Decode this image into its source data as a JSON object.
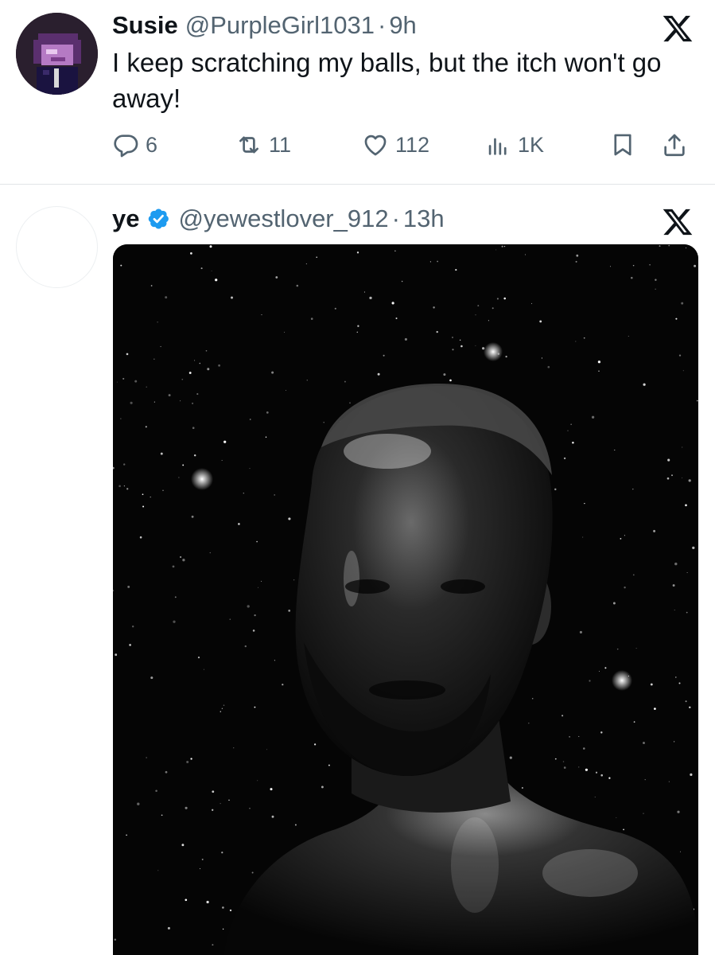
{
  "tweets": [
    {
      "display_name": "Susie",
      "handle": "@PurpleGirl1031",
      "separator": "·",
      "time": "9h",
      "text": "I keep scratching my balls, but the itch won't go away!",
      "stats": {
        "replies": "6",
        "retweets": "11",
        "likes": "112",
        "views": "1K"
      },
      "avatar_icon": "pixel-character-avatar",
      "menu_icon": "x-logo-icon"
    },
    {
      "display_name": "ye",
      "verified": true,
      "handle": "@yewestlover_912",
      "separator": "·",
      "time": "13h",
      "avatar_icon": "blank-avatar",
      "menu_icon": "x-logo-icon",
      "media": "chrome-portrait-starfield-image"
    }
  ],
  "colors": {
    "text_primary": "#0f1419",
    "text_secondary": "#536471",
    "verified_blue": "#1d9bf0",
    "divider": "#e1e4e8"
  }
}
